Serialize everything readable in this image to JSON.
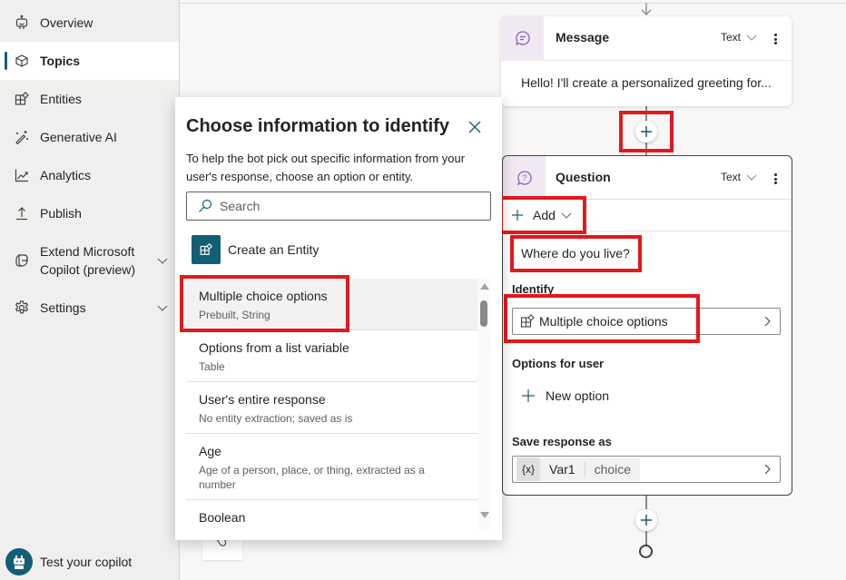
{
  "sidebar": {
    "items": [
      {
        "label": "Overview",
        "icon": "bot-icon",
        "active": false
      },
      {
        "label": "Topics",
        "icon": "cube-icon",
        "active": true
      },
      {
        "label": "Entities",
        "icon": "entity-icon",
        "active": false
      },
      {
        "label": "Generative AI",
        "icon": "magic-wand-icon",
        "active": false
      },
      {
        "label": "Analytics",
        "icon": "chart-icon",
        "active": false
      },
      {
        "label": "Publish",
        "icon": "upload-icon",
        "active": false
      },
      {
        "label": "Extend Microsoft Copilot (preview)",
        "label_line1": "Extend Microsoft",
        "label_line2": "Copilot (preview)",
        "icon": "copilot-icon",
        "expandable": true
      },
      {
        "label": "Settings",
        "icon": "gear-icon",
        "expandable": true
      }
    ],
    "test_copilot_label": "Test your copilot"
  },
  "canvas": {
    "message_node": {
      "title": "Message",
      "type_label": "Text",
      "text": "Hello! I'll create a personalized greeting for..."
    },
    "question_node": {
      "title": "Question",
      "type_label": "Text",
      "add_label": "Add",
      "question_text": "Where do you live?",
      "identify_label": "Identify",
      "identify_value": "Multiple choice options",
      "options_label": "Options for user",
      "new_option_label": "New option",
      "save_label": "Save response as",
      "var_icon": "{x}",
      "var_name": "Var1",
      "var_type": "choice"
    }
  },
  "dialog": {
    "title": "Choose information to identify",
    "description": "To help the bot pick out specific information from your user's response, choose an option or entity.",
    "search_placeholder": "Search",
    "create_entity_label": "Create an Entity",
    "items": [
      {
        "title": "Multiple choice options",
        "subtitle": "Prebuilt, String",
        "selected": true
      },
      {
        "title": "Options from a list variable",
        "subtitle": "Table"
      },
      {
        "title": "User's entire response",
        "subtitle": "No entity extraction; saved as is"
      },
      {
        "title": "Age",
        "subtitle": "Age of a person, place, or thing, extracted as a number"
      },
      {
        "title": "Boolean",
        "subtitle": ""
      }
    ]
  },
  "colors": {
    "accent": "#125e75",
    "highlight_box": "#e3191d",
    "node_icon_bg": "#f0e9f2"
  }
}
